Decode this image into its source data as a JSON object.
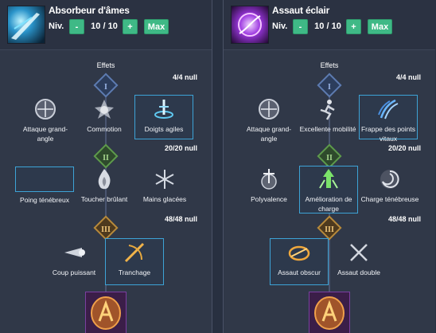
{
  "panels": [
    {
      "title": "Absorbeur d'âmes",
      "level_label": "Niv.",
      "level_value": "10 / 10",
      "minus_label": "-",
      "plus_label": "+",
      "max_label": "Max",
      "effects_label": "Effets",
      "tier_points": [
        "4/4 null",
        "20/20 null",
        "48/48 null"
      ],
      "tiers": [
        "I",
        "II",
        "III"
      ],
      "tier1": [
        "Attaque grand-angle",
        "Commotion",
        "Doigts agiles"
      ],
      "tier2": [
        "Poing ténébreux",
        "Toucher brûlant",
        "Mains glacées"
      ],
      "tier3": [
        "Coup puissant",
        "Tranchage"
      ]
    },
    {
      "title": "Assaut éclair",
      "level_label": "Niv.",
      "level_value": "10 / 10",
      "minus_label": "-",
      "plus_label": "+",
      "max_label": "Max",
      "effects_label": "Effets",
      "tier_points": [
        "4/4 null",
        "20/20 null",
        "48/48 null"
      ],
      "tiers": [
        "I",
        "II",
        "III"
      ],
      "tier1": [
        "Attaque grand-angle",
        "Excellente mobilité",
        "Frappe des points vitaux"
      ],
      "tier2": [
        "Polyvalence",
        "Amélioration de charge",
        "Charge ténébreuse"
      ],
      "tier3": [
        "Assaut obscur",
        "Assaut double"
      ]
    }
  ],
  "colors": {
    "panel_bg": "#303848",
    "button_green": "#3fb986",
    "selected_border": "#3da3d6"
  }
}
